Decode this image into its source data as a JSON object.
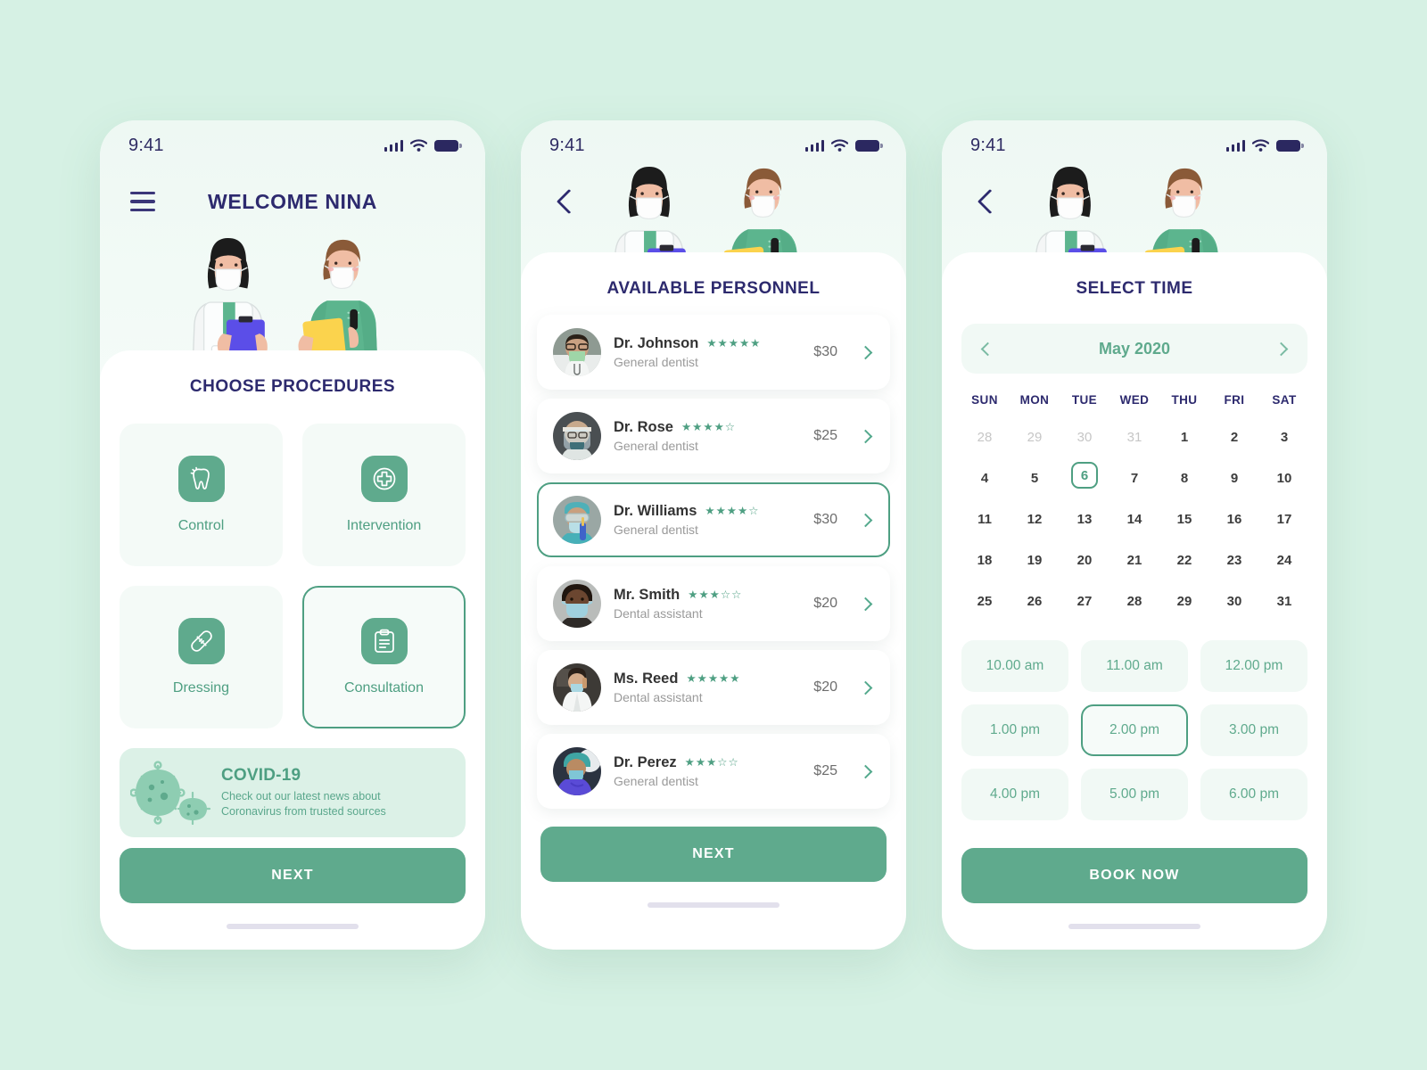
{
  "theme": {
    "page_bg": "#d6f1e4",
    "accent_green": "#5faa8d",
    "accent_green_dark": "#4e9f82",
    "title_navy": "#2d2a6e",
    "card_bg": "#ffffff",
    "soft_green_bg": "#f1f9f5"
  },
  "status_bar": {
    "time": "9:41",
    "signal_icon": "signal-bars-icon",
    "wifi_icon": "wifi-icon",
    "battery_icon": "battery-icon"
  },
  "screen1": {
    "menu_icon": "hamburger-menu-icon",
    "title": "WELCOME NINA",
    "illustration_name": "two-medical-staff-illustration",
    "sheet_title": "CHOOSE PROCEDURES",
    "procedures": [
      {
        "label": "Control",
        "icon": "tooth-icon",
        "selected": false
      },
      {
        "label": "Intervention",
        "icon": "medical-cross-circle-icon",
        "selected": false
      },
      {
        "label": "Dressing",
        "icon": "bandage-icon",
        "selected": false
      },
      {
        "label": "Consultation",
        "icon": "clipboard-icon",
        "selected": true
      }
    ],
    "covid_banner": {
      "icon": "virus-icon",
      "title": "COVID-19",
      "line1": "Check out our latest news about",
      "line2": "Coronavirus from trusted sources"
    },
    "next_label": "NEXT"
  },
  "screen2": {
    "back_icon": "chevron-left-icon",
    "illustration_name": "two-medical-staff-illustration",
    "sheet_title": "AVAILABLE PERSONNEL",
    "personnel": [
      {
        "name": "Dr. Johnson",
        "role": "General dentist",
        "rating": 5,
        "stars": "★★★★★",
        "price": "$30",
        "selected": false,
        "avatar": "doctor-green-mask-avatar"
      },
      {
        "name": "Dr. Rose",
        "role": "General dentist",
        "rating": 4,
        "stars": "★★★★☆",
        "price": "$25",
        "selected": false,
        "avatar": "doctor-face-shield-avatar"
      },
      {
        "name": "Dr. Williams",
        "role": "General dentist",
        "rating": 4,
        "stars": "★★★★☆",
        "price": "$30",
        "selected": true,
        "avatar": "surgeon-blue-gloves-avatar"
      },
      {
        "name": "Mr. Smith",
        "role": "Dental assistant",
        "rating": 3,
        "stars": "★★★☆☆",
        "price": "$20",
        "selected": false,
        "avatar": "assistant-blue-mask-avatar"
      },
      {
        "name": "Ms. Reed",
        "role": "Dental assistant",
        "rating": 5,
        "stars": "★★★★★",
        "price": "$20",
        "selected": false,
        "avatar": "assistant-labcoat-avatar"
      },
      {
        "name": "Dr. Perez",
        "role": "General dentist",
        "rating": 3,
        "stars": "★★★☆☆",
        "price": "$25",
        "selected": false,
        "avatar": "dentist-purple-scrubs-avatar"
      }
    ],
    "next_label": "NEXT"
  },
  "screen3": {
    "back_icon": "chevron-left-icon",
    "illustration_name": "two-medical-staff-illustration",
    "sheet_title": "SELECT TIME",
    "calendar": {
      "month_label": "May 2020",
      "prev_icon": "chevron-left-icon",
      "next_icon": "chevron-right-icon",
      "weekdays": [
        "SUN",
        "MON",
        "TUE",
        "WED",
        "THU",
        "FRI",
        "SAT"
      ],
      "selected_day": 6,
      "weeks": [
        [
          {
            "d": "28",
            "muted": true
          },
          {
            "d": "29",
            "muted": true
          },
          {
            "d": "30",
            "muted": true
          },
          {
            "d": "31",
            "muted": true
          },
          {
            "d": "1"
          },
          {
            "d": "2"
          },
          {
            "d": "3"
          }
        ],
        [
          {
            "d": "4"
          },
          {
            "d": "5"
          },
          {
            "d": "6",
            "sel": true
          },
          {
            "d": "7"
          },
          {
            "d": "8"
          },
          {
            "d": "9"
          },
          {
            "d": "10"
          }
        ],
        [
          {
            "d": "11"
          },
          {
            "d": "12"
          },
          {
            "d": "13"
          },
          {
            "d": "14"
          },
          {
            "d": "15"
          },
          {
            "d": "16"
          },
          {
            "d": "17"
          }
        ],
        [
          {
            "d": "18"
          },
          {
            "d": "19"
          },
          {
            "d": "20"
          },
          {
            "d": "21"
          },
          {
            "d": "22"
          },
          {
            "d": "23"
          },
          {
            "d": "24"
          }
        ],
        [
          {
            "d": "25"
          },
          {
            "d": "26"
          },
          {
            "d": "27"
          },
          {
            "d": "28"
          },
          {
            "d": "29"
          },
          {
            "d": "30"
          },
          {
            "d": "31"
          }
        ]
      ]
    },
    "time_slots": [
      {
        "label": "10.00 am",
        "selected": false
      },
      {
        "label": "11.00 am",
        "selected": false
      },
      {
        "label": "12.00 pm",
        "selected": false
      },
      {
        "label": "1.00 pm",
        "selected": false
      },
      {
        "label": "2.00 pm",
        "selected": true
      },
      {
        "label": "3.00 pm",
        "selected": false
      },
      {
        "label": "4.00 pm",
        "selected": false
      },
      {
        "label": "5.00 pm",
        "selected": false
      },
      {
        "label": "6.00 pm",
        "selected": false
      }
    ],
    "book_label": "BOOK NOW"
  }
}
